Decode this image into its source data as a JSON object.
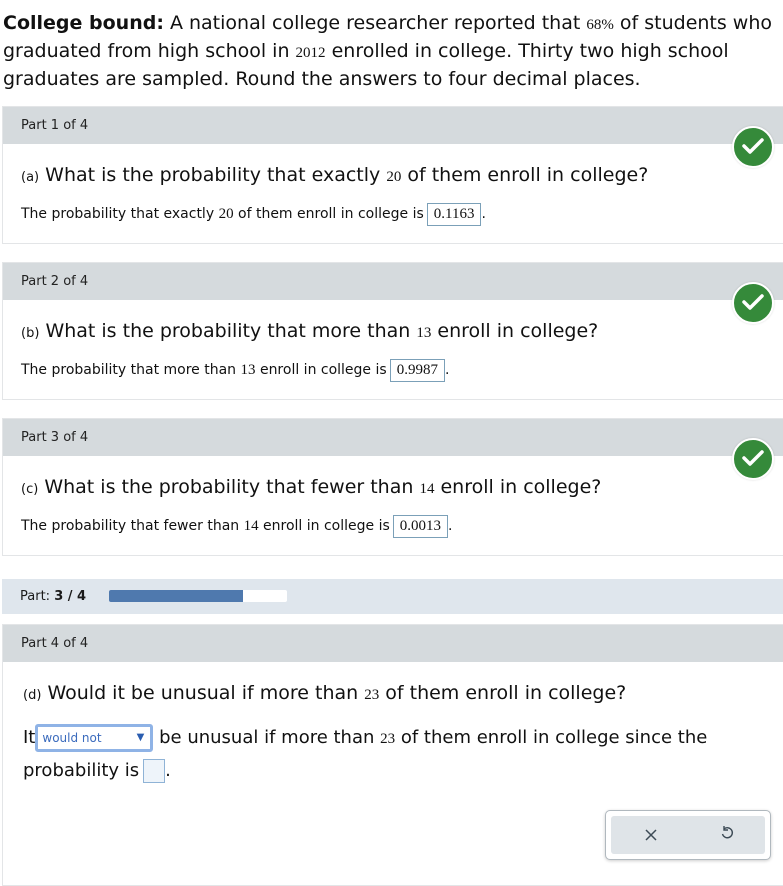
{
  "intro": {
    "bold": "College bound:",
    "text1": " A national college researcher reported that ",
    "pct": "68%",
    "text2": " of students who graduated from high school in ",
    "year": "2012",
    "text3": " enrolled in college. Thirty two high school graduates are sampled. Round the answers to four decimal places."
  },
  "parts": [
    {
      "header": "Part 1 of 4",
      "status_icon": "check-circle-icon",
      "q_label": "(a)",
      "q_text1": " What is the probability that exactly ",
      "q_num": "20",
      "q_text2": " of them enroll in college?",
      "ans_text1": "The probability that exactly ",
      "ans_num": "20",
      "ans_text2": " of them enroll in college is",
      "answer": "0.1163"
    },
    {
      "header": "Part 2 of 4",
      "status_icon": "check-circle-icon",
      "q_label": "(b)",
      "q_text1": " What is the probability that more than ",
      "q_num": "13",
      "q_text2": " enroll in college?",
      "ans_text1": "The probability that more than ",
      "ans_num": "13",
      "ans_text2": " enroll in college is",
      "answer": "0.9987"
    },
    {
      "header": "Part 3 of 4",
      "status_icon": "check-circle-icon",
      "q_label": "(c)",
      "q_text1": " What is the probability that fewer than ",
      "q_num": "14",
      "q_text2": " enroll in college?",
      "ans_text1": "The probability that fewer than ",
      "ans_num": "14",
      "ans_text2": " enroll in college is",
      "answer": "0.0013"
    }
  ],
  "progress": {
    "label": "Part: ",
    "value_text": "3 / 4",
    "fraction": 0.75
  },
  "part4": {
    "header": "Part 4 of 4",
    "q_label": "(d)",
    "q_text1": " Would it be unusual if more than ",
    "q_num": "23",
    "q_text2": " of them enroll in college?",
    "ans_it": "It",
    "select_value": "would not",
    "ans_text1": "be unusual if more than ",
    "ans_num": "23",
    "ans_text2": " of them enroll in college since the probability is",
    "answer": ""
  },
  "tools": {
    "clear_icon": "close-icon",
    "undo_icon": "undo-icon"
  }
}
